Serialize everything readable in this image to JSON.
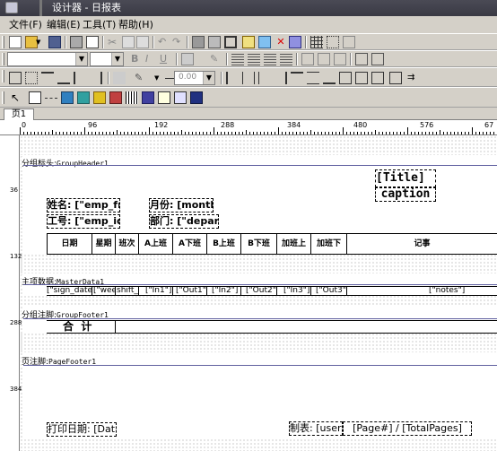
{
  "window": {
    "title": "设计器 - 日报表"
  },
  "menu": {
    "items": [
      "文件(F)",
      "编辑(E)",
      "工具(T)",
      "帮助(H)"
    ]
  },
  "toolbar": {
    "zoom_value": "0.00"
  },
  "tabs": [
    "页1"
  ],
  "ruler": {
    "labels": [
      "0",
      "96",
      "192",
      "288",
      "384",
      "480",
      "576",
      "67"
    ]
  },
  "vruler": {
    "labels": [
      "36",
      "132",
      "288",
      "384"
    ]
  },
  "bands": {
    "group_header": {
      "title": "分组标头:",
      "name": "GroupHeader1"
    },
    "master_data": {
      "title": "主项数据:",
      "name": "MasterData1"
    },
    "group_footer": {
      "title": "分组注脚:",
      "name": "GroupFooter1"
    },
    "page_footer": {
      "title": "页注脚:",
      "name": "PageFooter1"
    }
  },
  "header": {
    "title_field": "[Title]",
    "caption": "caption",
    "name_label": "姓名: [\"emp_fna",
    "month_label": "月份: [month]",
    "id_label": "工号: [\"emp_id\"",
    "dept_label": "部门: [\"depart",
    "columns": [
      "日期",
      "星期",
      "班次",
      "A上班",
      "A下班",
      "B上班",
      "B下班",
      "加班上",
      "加班下",
      "记事"
    ]
  },
  "data_row": [
    "[\"sign_date\"",
    "[\"week",
    "shift_i",
    "[\"In1\"]",
    "[\"Out1\"]",
    "[\"In2\"]",
    "[\"Out2\"]",
    "[\"In3\"]",
    "[\"Out3\"]",
    "[\"notes\"]"
  ],
  "footer": {
    "total": "合  计"
  },
  "page_footer": {
    "print_date": "打印日期: [Dat",
    "maker": "制表: [user",
    "page": "[Page#] / [TotalPages]"
  }
}
